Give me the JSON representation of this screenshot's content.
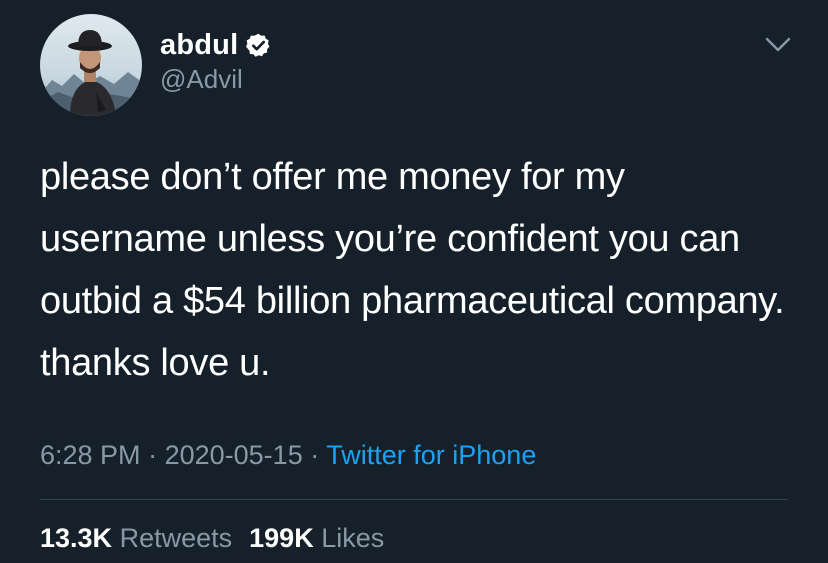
{
  "author": {
    "display_name": "abdul",
    "handle": "@Advil",
    "verified": true,
    "avatar_icon": "profile-photo-man-in-hat"
  },
  "tweet": {
    "text": "please don’t offer me money for my username unless you’re confident you can outbid a $54 billion pharmaceutical company. thanks love u."
  },
  "meta": {
    "time": "6:28 PM",
    "separator": "·",
    "date": "2020-05-15",
    "source": "Twitter for iPhone"
  },
  "stats": {
    "retweets_count": "13.3K",
    "retweets_label": "Retweets",
    "likes_count": "199K",
    "likes_label": "Likes"
  },
  "icons": {
    "verified": "verified-badge-icon",
    "menu": "chevron-down-icon"
  },
  "colors": {
    "background": "#15202b",
    "primary_text": "#ffffff",
    "secondary_text": "#8899a6",
    "link": "#1da1f2",
    "divider": "#38444d"
  }
}
